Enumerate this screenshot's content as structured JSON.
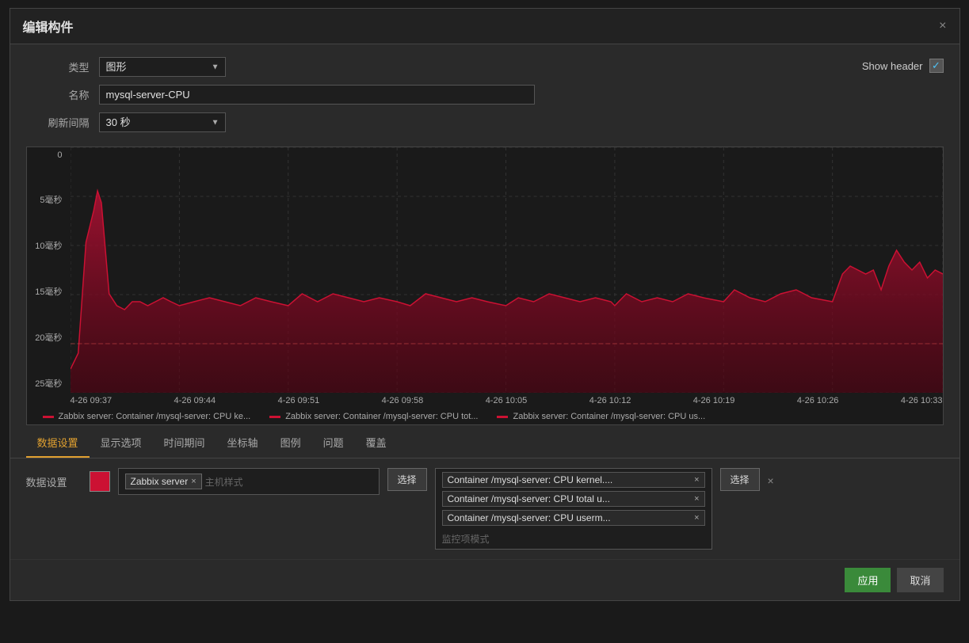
{
  "dialog": {
    "title": "编辑构件",
    "close_label": "×"
  },
  "form": {
    "type_label": "类型",
    "type_value": "图形",
    "name_label": "名称",
    "name_value": "mysql-server-CPU",
    "refresh_label": "刷新间隔",
    "refresh_value": "30 秒",
    "show_header_label": "Show header"
  },
  "chart": {
    "y_labels": [
      "0",
      "5毫秒",
      "10毫秒",
      "15毫秒",
      "20毫秒",
      "25毫秒"
    ],
    "x_labels": [
      "4-26 09:37",
      "4-26 09:44",
      "4-26 09:51",
      "4-26 09:58",
      "4-26 10:05",
      "4-26 10:12",
      "4-26 10:19",
      "4-26 10:26",
      "4-26 10:33"
    ],
    "legend": [
      {
        "color": "#cc1133",
        "text": "Zabbix server: Container /mysql-server: CPU ke..."
      },
      {
        "color": "#cc1133",
        "text": "Zabbix server: Container /mysql-server: CPU tot..."
      },
      {
        "color": "#cc1133",
        "text": "Zabbix server: Container /mysql-server: CPU us..."
      }
    ]
  },
  "tabs": {
    "items": [
      {
        "label": "数据设置",
        "active": true
      },
      {
        "label": "显示选项",
        "active": false
      },
      {
        "label": "时间期间",
        "active": false
      },
      {
        "label": "坐标轴",
        "active": false
      },
      {
        "label": "图例",
        "active": false
      },
      {
        "label": "问题",
        "active": false
      },
      {
        "label": "覆盖",
        "active": false
      }
    ]
  },
  "data_settings": {
    "section_label": "数据设置",
    "color_value": "#EE465C",
    "host_label": "Zabbix server",
    "host_remove": "×",
    "host_placeholder": "主机样式",
    "select_btn": "选择",
    "items": [
      {
        "text": "Container /mysql-server: CPU kernel....",
        "remove": "×"
      },
      {
        "text": "Container /mysql-server: CPU total u...",
        "remove": "×"
      },
      {
        "text": "Container /mysql-server: CPU userm...",
        "remove": "×"
      }
    ],
    "item_placeholder": "监控项模式",
    "select_item_btn": "选择",
    "delete_icon": "×"
  },
  "footer": {
    "apply_label": "应用",
    "cancel_label": "取消"
  }
}
